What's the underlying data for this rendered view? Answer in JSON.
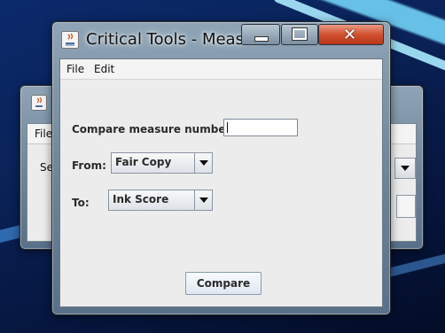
{
  "desktop": {
    "accent": "#78dcff"
  },
  "back_window": {
    "menu": {
      "file": "File"
    },
    "label_partial": "Se"
  },
  "window": {
    "title": "Critical Tools - Meas...",
    "controls": {
      "minimize": "minimize-icon",
      "maximize": "maximize-icon",
      "close": "✕"
    },
    "menu": {
      "file": "File",
      "edit": "Edit"
    },
    "form": {
      "compare_label": "Compare measure number:",
      "compare_value": "",
      "from_label": "From:",
      "from_value": "Fair Copy",
      "to_label": "To:",
      "to_value": "Ink Score",
      "compare_button": "Compare"
    }
  }
}
